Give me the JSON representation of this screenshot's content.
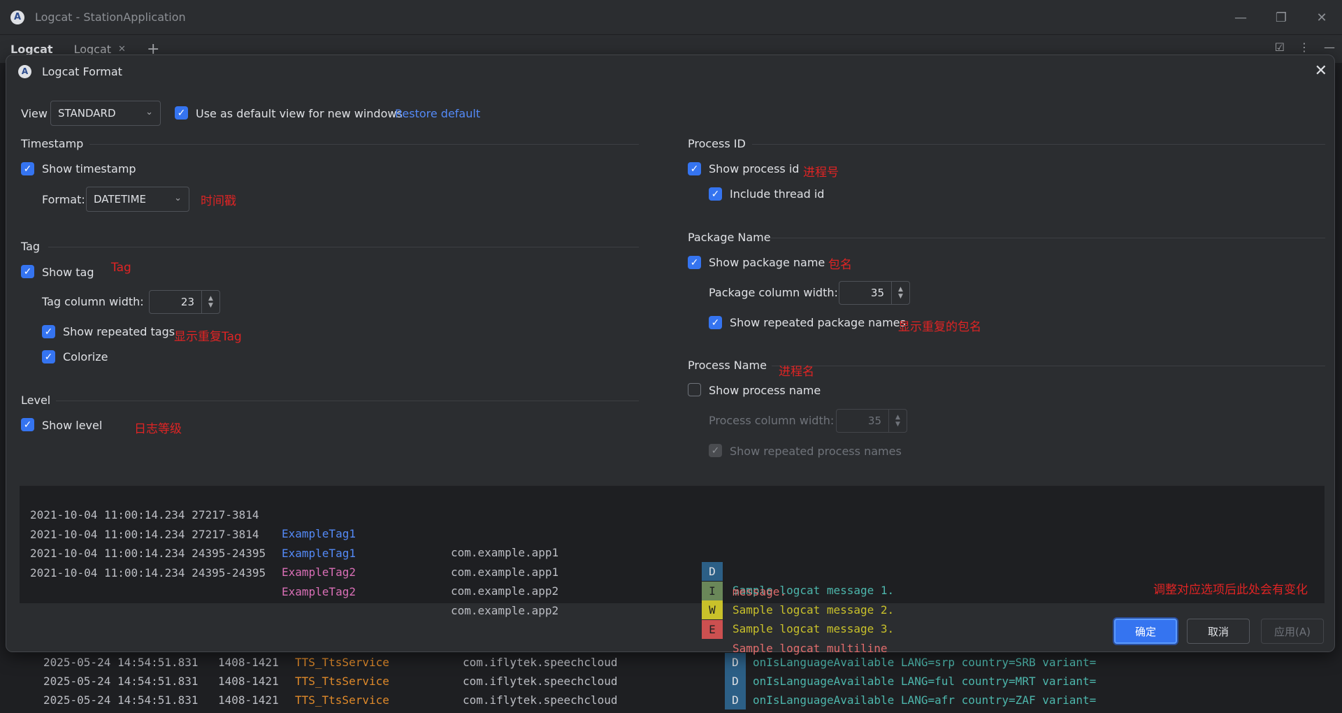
{
  "window": {
    "title": "Logcat - StationApplication",
    "tabs": [
      "Logcat",
      "Logcat"
    ]
  },
  "dialog": {
    "title": "Logcat Format",
    "view_label": "View",
    "view_value": "STANDARD",
    "use_default_label": "Use as default view for new windows",
    "restore_default": "Restore default",
    "timestamp": {
      "section": "Timestamp",
      "show_label": "Show timestamp",
      "format_label": "Format:",
      "format_value": "DATETIME",
      "annotation": "时间戳"
    },
    "tag": {
      "section": "Tag",
      "show_label": "Show tag",
      "annotation": "Tag",
      "width_label": "Tag column width:",
      "width_value": "23",
      "repeated_label": "Show repeated tags",
      "repeated_annotation": "显示重复Tag",
      "colorize_label": "Colorize"
    },
    "level": {
      "section": "Level",
      "show_label": "Show level",
      "annotation": "日志等级"
    },
    "process_id": {
      "section": "Process ID",
      "show_label": "Show process id",
      "annotation": "进程号",
      "thread_label": "Include thread id"
    },
    "package": {
      "section": "Package Name",
      "show_label": "Show package name",
      "annotation": "包名",
      "width_label": "Package column width:",
      "width_value": "35",
      "repeated_label": "Show repeated package names",
      "repeated_annotation": "显示重复的包名"
    },
    "process_name": {
      "section": "Process Name",
      "annotation": "进程名",
      "show_label": "Show process name",
      "width_label": "Process column width:",
      "width_value": "35",
      "repeated_label": "Show repeated process names"
    },
    "preview": {
      "rows": [
        {
          "ts": "2021-10-04 11:00:14.234 27217-3814",
          "tag": "ExampleTag1",
          "pkg": "com.example.app1",
          "level": "D",
          "msg": "Sample logcat message 1."
        },
        {
          "ts": "2021-10-04 11:00:14.234 27217-3814",
          "tag": "ExampleTag1",
          "pkg": "com.example.app1",
          "level": "I",
          "msg": "Sample logcat message 2."
        },
        {
          "ts": "2021-10-04 11:00:14.234 24395-24395",
          "tag": "ExampleTag2",
          "pkg": "com.example.app2",
          "level": "W",
          "msg": "Sample logcat message 3."
        },
        {
          "ts": "2021-10-04 11:00:14.234 24395-24395",
          "tag": "ExampleTag2",
          "pkg": "com.example.app2",
          "level": "E",
          "msg": "Sample logcat multiline"
        }
      ],
      "continuation": "message.",
      "annotation": "调整对应选项后此处会有变化"
    },
    "buttons": {
      "ok": "确定",
      "cancel": "取消",
      "apply": "应用(A)"
    }
  },
  "background_log": [
    {
      "ts": "2025-05-24 14:54:51.831",
      "pid": "1408-1421",
      "tag": "TTS_TtsService",
      "pkg": "com.iflytek.speechcloud",
      "level": "D",
      "msg": "onIsLanguageAvailable LANG=srp country=SRB variant="
    },
    {
      "ts": "2025-05-24 14:54:51.831",
      "pid": "1408-1421",
      "tag": "TTS_TtsService",
      "pkg": "com.iflytek.speechcloud",
      "level": "D",
      "msg": "onIsLanguageAvailable LANG=ful country=MRT variant="
    },
    {
      "ts": "2025-05-24 14:54:51.831",
      "pid": "1408-1421",
      "tag": "TTS_TtsService",
      "pkg": "com.iflytek.speechcloud",
      "level": "D",
      "msg": "onIsLanguageAvailable LANG=afr country=ZAF variant="
    }
  ],
  "colors": {
    "accent": "#3574f0",
    "annotation": "#e02424",
    "tag1": "#548af7",
    "tag2": "#d96fb6",
    "level_D": "#2c5f86",
    "level_I": "#6a8759",
    "level_W": "#c9c12a",
    "level_E": "#cc5050",
    "msg_D": "#4db6ac",
    "msg_I": "#c9c12a",
    "msg_W": "#c9c12a",
    "msg_E": "#e06c6c"
  }
}
